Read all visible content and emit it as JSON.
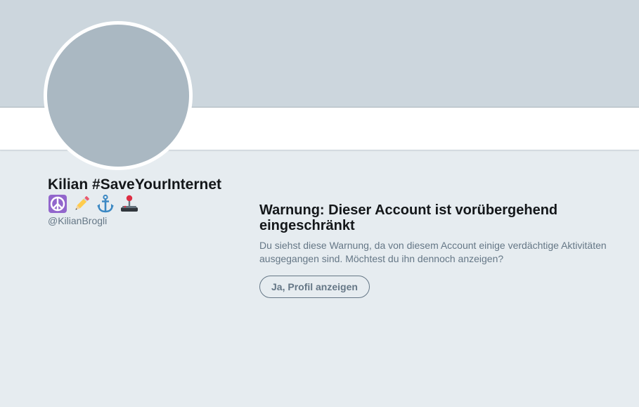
{
  "profile": {
    "name": "Kilian #SaveYourInternet",
    "handle": "@KilianBrogli",
    "name_emojis": [
      "peace-symbol",
      "pencil",
      "anchor",
      "joystick"
    ]
  },
  "warning": {
    "title": "Warnung: Dieser Account ist vorübergehend eingeschränkt",
    "text": "Du siehst diese Warnung, da von diesem Account einige verdächtige Aktivitäten ausgegangen sind. Möchtest du ihn dennoch anzeigen?",
    "button_label": "Ja, Profil anzeigen"
  },
  "colors": {
    "background": "#e6ecf0",
    "banner": "#ccd6dd",
    "avatar_placeholder": "#aab8c2",
    "primary_text": "#14171a",
    "secondary_text": "#657786"
  }
}
